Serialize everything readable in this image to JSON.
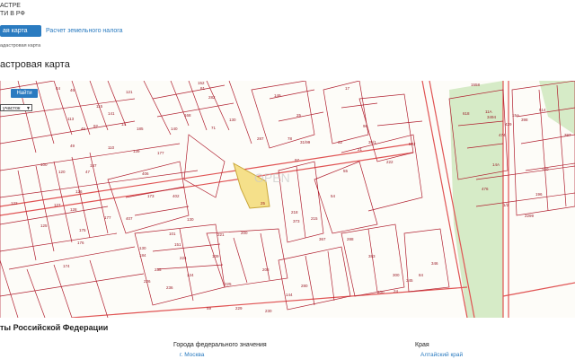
{
  "header": {
    "brand_line1": "АСТРЕ",
    "brand_line2": "ТИ В РФ"
  },
  "tabs": [
    {
      "label": "ая карта"
    },
    {
      "label": "Расчет земельного налога"
    }
  ],
  "breadcrumb": "адастровая карта",
  "page_title": "астровая карта",
  "search": {
    "button_label": "Найти",
    "select_value": "участок"
  },
  "map": {
    "parcel_labels": [
      "44",
      "46",
      "121",
      "141",
      "113",
      "45",
      "92",
      "110",
      "49",
      "115",
      "14",
      "185",
      "187",
      "47",
      "139",
      "177",
      "406",
      "122",
      "100",
      "120",
      "126",
      "127",
      "128",
      "125",
      "173",
      "402",
      "177",
      "407",
      "175",
      "176",
      "174",
      "130",
      "184",
      "101",
      "151",
      "152",
      "81",
      "282",
      "168",
      "140",
      "71",
      "130",
      "149",
      "25",
      "287",
      "31/99",
      "97",
      "96",
      "35/1",
      "512",
      "78",
      "32",
      "21",
      "222",
      "55",
      "54",
      "218",
      "373",
      "215",
      "367",
      "200",
      "130",
      "139",
      "224",
      "221",
      "124",
      "226",
      "236",
      "235",
      "225",
      "144",
      "280",
      "208",
      "288",
      "383",
      "300",
      "345",
      "84",
      "346",
      "59",
      "229",
      "230",
      "200",
      "24",
      "25",
      "17",
      "1558",
      "618",
      "3494",
      "514",
      "474",
      "14А",
      "15А",
      "11А",
      "429",
      "398",
      "120",
      "476",
      "196",
      "2299",
      "1/2",
      "397",
      "396",
      "474"
    ],
    "overlay_watermark": "OPEN",
    "colors": {
      "parcel_line": "#b01f2f",
      "highlight": "#f5e08a",
      "road": "#e24b4b",
      "green": "#cfe6c0"
    }
  },
  "regions": {
    "title": "ты Российской Федерации",
    "col1_header": "Города федерального значения",
    "col1_link": "г. Москва",
    "col2_header": "Края",
    "col2_link": "Алтайский край"
  }
}
